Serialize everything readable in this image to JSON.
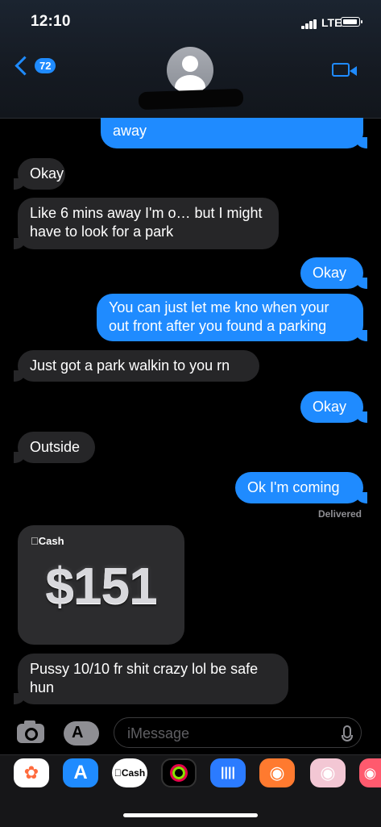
{
  "status": {
    "time": "12:10",
    "network": "LTE"
  },
  "header": {
    "back_badge": "72"
  },
  "messages": [
    {
      "side": "out",
      "text": "away"
    },
    {
      "side": "in",
      "text": "Okay"
    },
    {
      "side": "in",
      "text": "Like 6 mins away I'm o… but I might have to look for a park"
    },
    {
      "side": "out",
      "text": "Okay"
    },
    {
      "side": "out",
      "text": "You can just let me kno when your out front after you found a parking"
    },
    {
      "side": "in",
      "text": "Just got a park walkin to you rn"
    },
    {
      "side": "out",
      "text": "Okay"
    },
    {
      "side": "in",
      "text": "Outside"
    },
    {
      "side": "out",
      "text": "Ok I'm coming"
    },
    {
      "side": "in",
      "text": "Pussy 10/10 fr shit crazy lol be safe hun"
    }
  ],
  "delivered": "Delivered",
  "cash_card": {
    "label": "Cash",
    "amount": "$151"
  },
  "composer": {
    "placeholder": "iMessage"
  },
  "app_drawer": {
    "cash_label": "Cash"
  }
}
